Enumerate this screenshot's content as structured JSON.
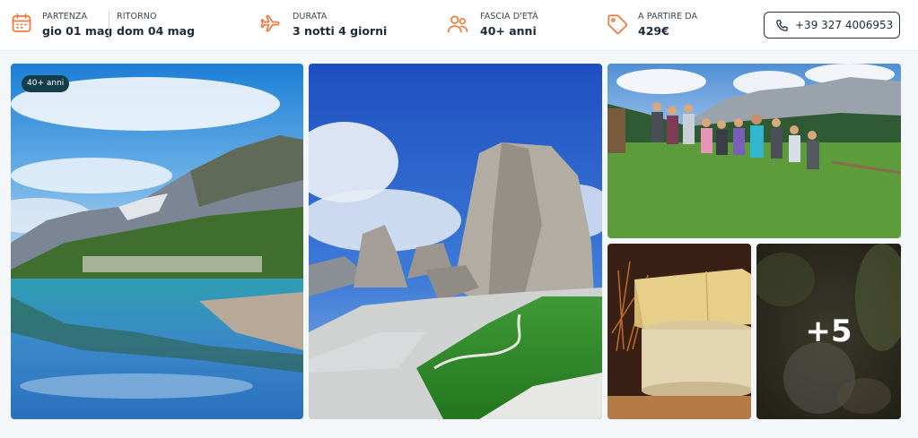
{
  "trip": {
    "departure": {
      "label": "PARTENZA",
      "value": "gio 01 mag"
    },
    "return": {
      "label": "RITORNO",
      "value": "dom 04 mag"
    },
    "duration": {
      "label": "DURATA",
      "value": "3 notti 4 giorni"
    },
    "age_range": {
      "label": "FASCIA D'ETÀ",
      "value": "40+ anni"
    },
    "price": {
      "label": "A PARTIRE DA",
      "value": "429€"
    }
  },
  "contact": {
    "phone": "+39 327 4006953",
    "icon": "phone-icon"
  },
  "gallery": {
    "age_badge": "40+ anni",
    "more_count": "+5"
  },
  "colors": {
    "accent": "#f07a3c",
    "badge": "#123d4a",
    "text": "#1c2b3a"
  }
}
